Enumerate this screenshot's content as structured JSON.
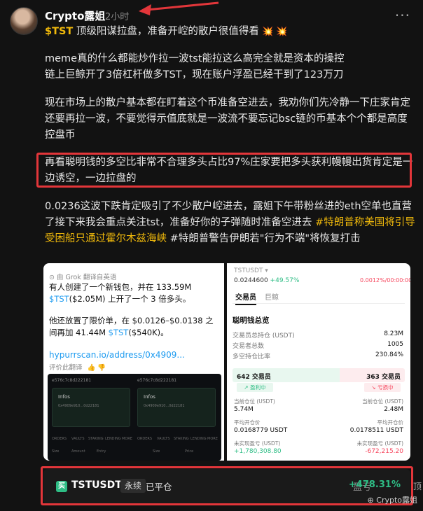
{
  "post": {
    "author": "Crypto露姐",
    "time": "2小时",
    "more": "···"
  },
  "body": {
    "line1_ticker": "$TST",
    "line1_text": " 顶级阳谋拉盘，准备开崆的散户很值得看",
    "line1_emoji": " 💥 💥",
    "para2": "meme真的什么都能炒作拉一波tst能拉这么高完全就是资本的操控\n链上巨鲸开了3倍杠杆做多TST，现在账户浮盈已经干到了123万刀",
    "para3": "现在市场上的散户基本都在盯着这个币准备空进去，我劝你们先冷静一下庄家肯定还要再拉一波，不要觉得示值底就是一波流不要忘记bsc链的币基本个个都是高度控盘币",
    "para4": "再看聪明钱的多空比非常不合理多头占比97%庄家要把多头获利幔幔出货肯定是一边诱空，一边拉盘的",
    "para5": "0.0236这波下跌肯定吸引了不少散户崆进去，露姐下午带粉丝进的eth空单也直营了接下来我会重点关注tst，准备好你的子弹随时准备空进去",
    "tag1": "#特朗普称美国将引导受困船只通过霍尔木兹海峡",
    "tag2": " #特朗普警告伊朗若\"行为不端\"将恢复打击"
  },
  "left_image": {
    "grok": "⊙ 由 Grok 翻译自英语",
    "p1_a": "有人创建了一个新钱包，并在 133.59M",
    "p1_ticker": "$TST",
    "p1_b": "($2.05M) 上开了一个 3 倍多头。",
    "p2_a": "他还放置了限价单，在 $0.0126–$0.0138 之间再加 41.44M ",
    "p2_ticker": "$TST",
    "p2_b": "($540K)。",
    "link": "hypurrscan.io/address/0x4909...",
    "rate": "评价此翻译",
    "rate_icons": "👍  👎",
    "shot": {
      "addr1": "e576c7c8d222181",
      "addr2": "e576c7c8d222181",
      "info": "Infos",
      "sub1": "0x4909e910...0d22181",
      "sub2": "0x4909e910...0d22181",
      "tabs": [
        "ORDERS",
        "VAULTS",
        "STAKING",
        "LENDING",
        "MORE"
      ],
      "foot": [
        "Size",
        "Amount",
        "Entry",
        "Price"
      ]
    }
  },
  "right_image": {
    "price": "0.0244600",
    "change": "+49.57%",
    "change2": "0.0012%/00:00:00",
    "tabs": [
      "交易员",
      "巨鲸"
    ],
    "section": "聪明钱总览",
    "rows": [
      {
        "label": "交易员总持仓 (USDT)",
        "value": "8.23M"
      },
      {
        "label": "交易者总数",
        "value": "1005"
      },
      {
        "label": "多空持仓比率",
        "value": "230.84%"
      }
    ],
    "long_count": "642 交易员",
    "short_count": "363 交易员",
    "long_pill": "↗ 盈利中",
    "short_pill": "↘ 亏损中",
    "long_share": 0.62,
    "pos_label": "当前仓位 (USDT)",
    "long_pos": "5.74M",
    "short_pos": "2.48M",
    "avg_label": "平均开仓价",
    "long_avg": "0.0168779 USDT",
    "short_avg": "0.0178511 USDT",
    "upnl_label": "未实现盈亏 (USDT)",
    "long_upnl": "+1,780,308.80",
    "short_upnl": "-672,215.20"
  },
  "position": {
    "icon": "买",
    "pair": "TSTUSDT",
    "type": "永续",
    "status": "已平仓",
    "pnl_label": "盈亏",
    "pnl_value": "+478.31%"
  },
  "watermark": "⊕ Crypto露姐",
  "edge": "顶"
}
